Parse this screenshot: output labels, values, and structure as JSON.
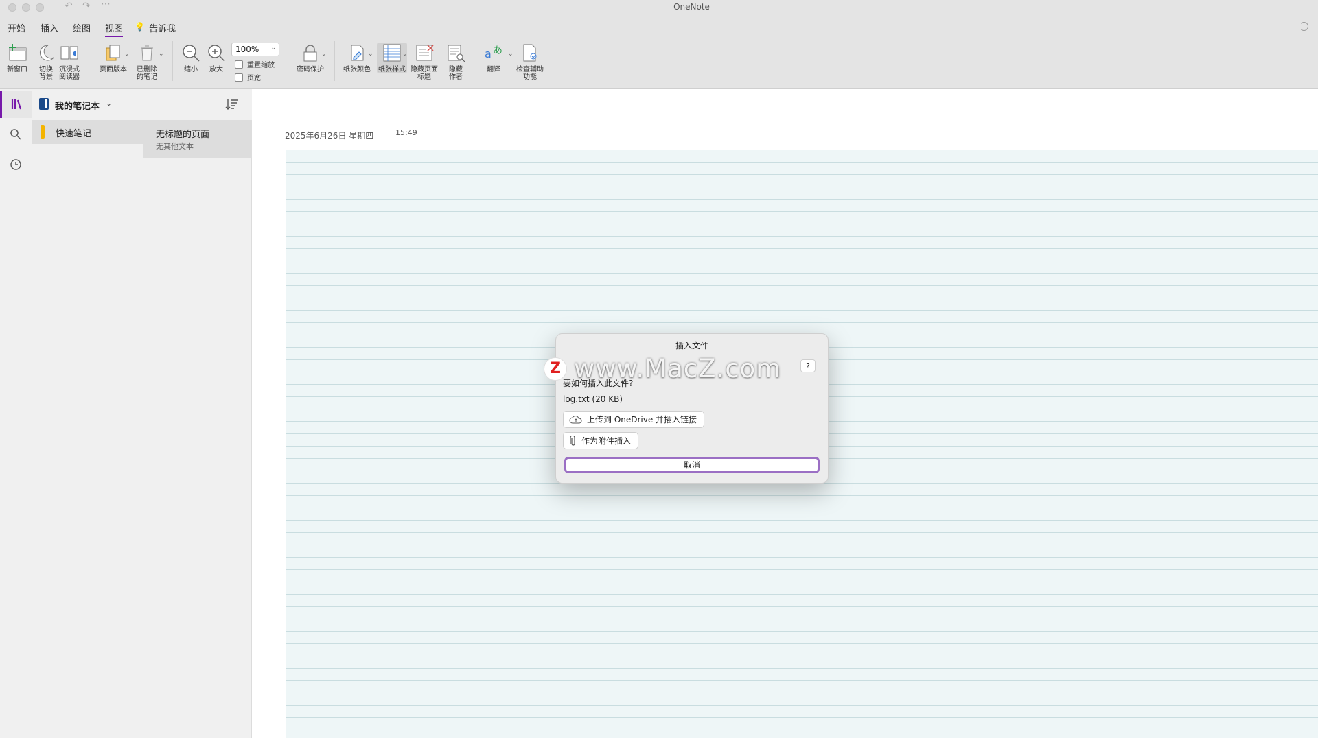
{
  "window": {
    "title": "OneNote"
  },
  "tabs": [
    {
      "label": "开始"
    },
    {
      "label": "插入"
    },
    {
      "label": "绘图"
    },
    {
      "label": "视图"
    },
    {
      "label": "告诉我"
    }
  ],
  "ribbon": {
    "new_window": "新窗口",
    "switch_bg": "切换\n背景",
    "immersive": "沉浸式\n阅读器",
    "page_versions": "页面版本",
    "deleted_notes": "已删除\n的笔记",
    "zoom_out": "缩小",
    "zoom_in": "放大",
    "zoom_value": "100%",
    "reset_zoom": "重置缩放",
    "page_width": "页宽",
    "password": "密码保护",
    "paper_color": "纸张颜色",
    "paper_style": "纸张样式",
    "hide_page_title": "隐藏页面\n标题",
    "hide_authors": "隐藏\n作者",
    "translate": "翻译",
    "accessibility": "检查辅助\n功能"
  },
  "notebook": {
    "name": "我的笔记本",
    "section": "快速笔记",
    "page_title": "无标题的页面",
    "page_sub": "无其他文本"
  },
  "canvas": {
    "date": "2025年6月26日 星期四",
    "time": "15:49"
  },
  "dialog": {
    "title": "插入文件",
    "help": "?",
    "question": "要如何插入此文件?",
    "file": "log.txt (20 KB)",
    "upload_label": "上传到 OneDrive 并插入链接",
    "attach_label": "作为附件插入",
    "cancel_label": "取消"
  },
  "watermark": {
    "badge": "Z",
    "text": "www.MacZ.com"
  },
  "colors": {
    "accent": "#7719aa",
    "section_yellow": "#f4b400",
    "notebook_blue": "#1b4a8a"
  }
}
